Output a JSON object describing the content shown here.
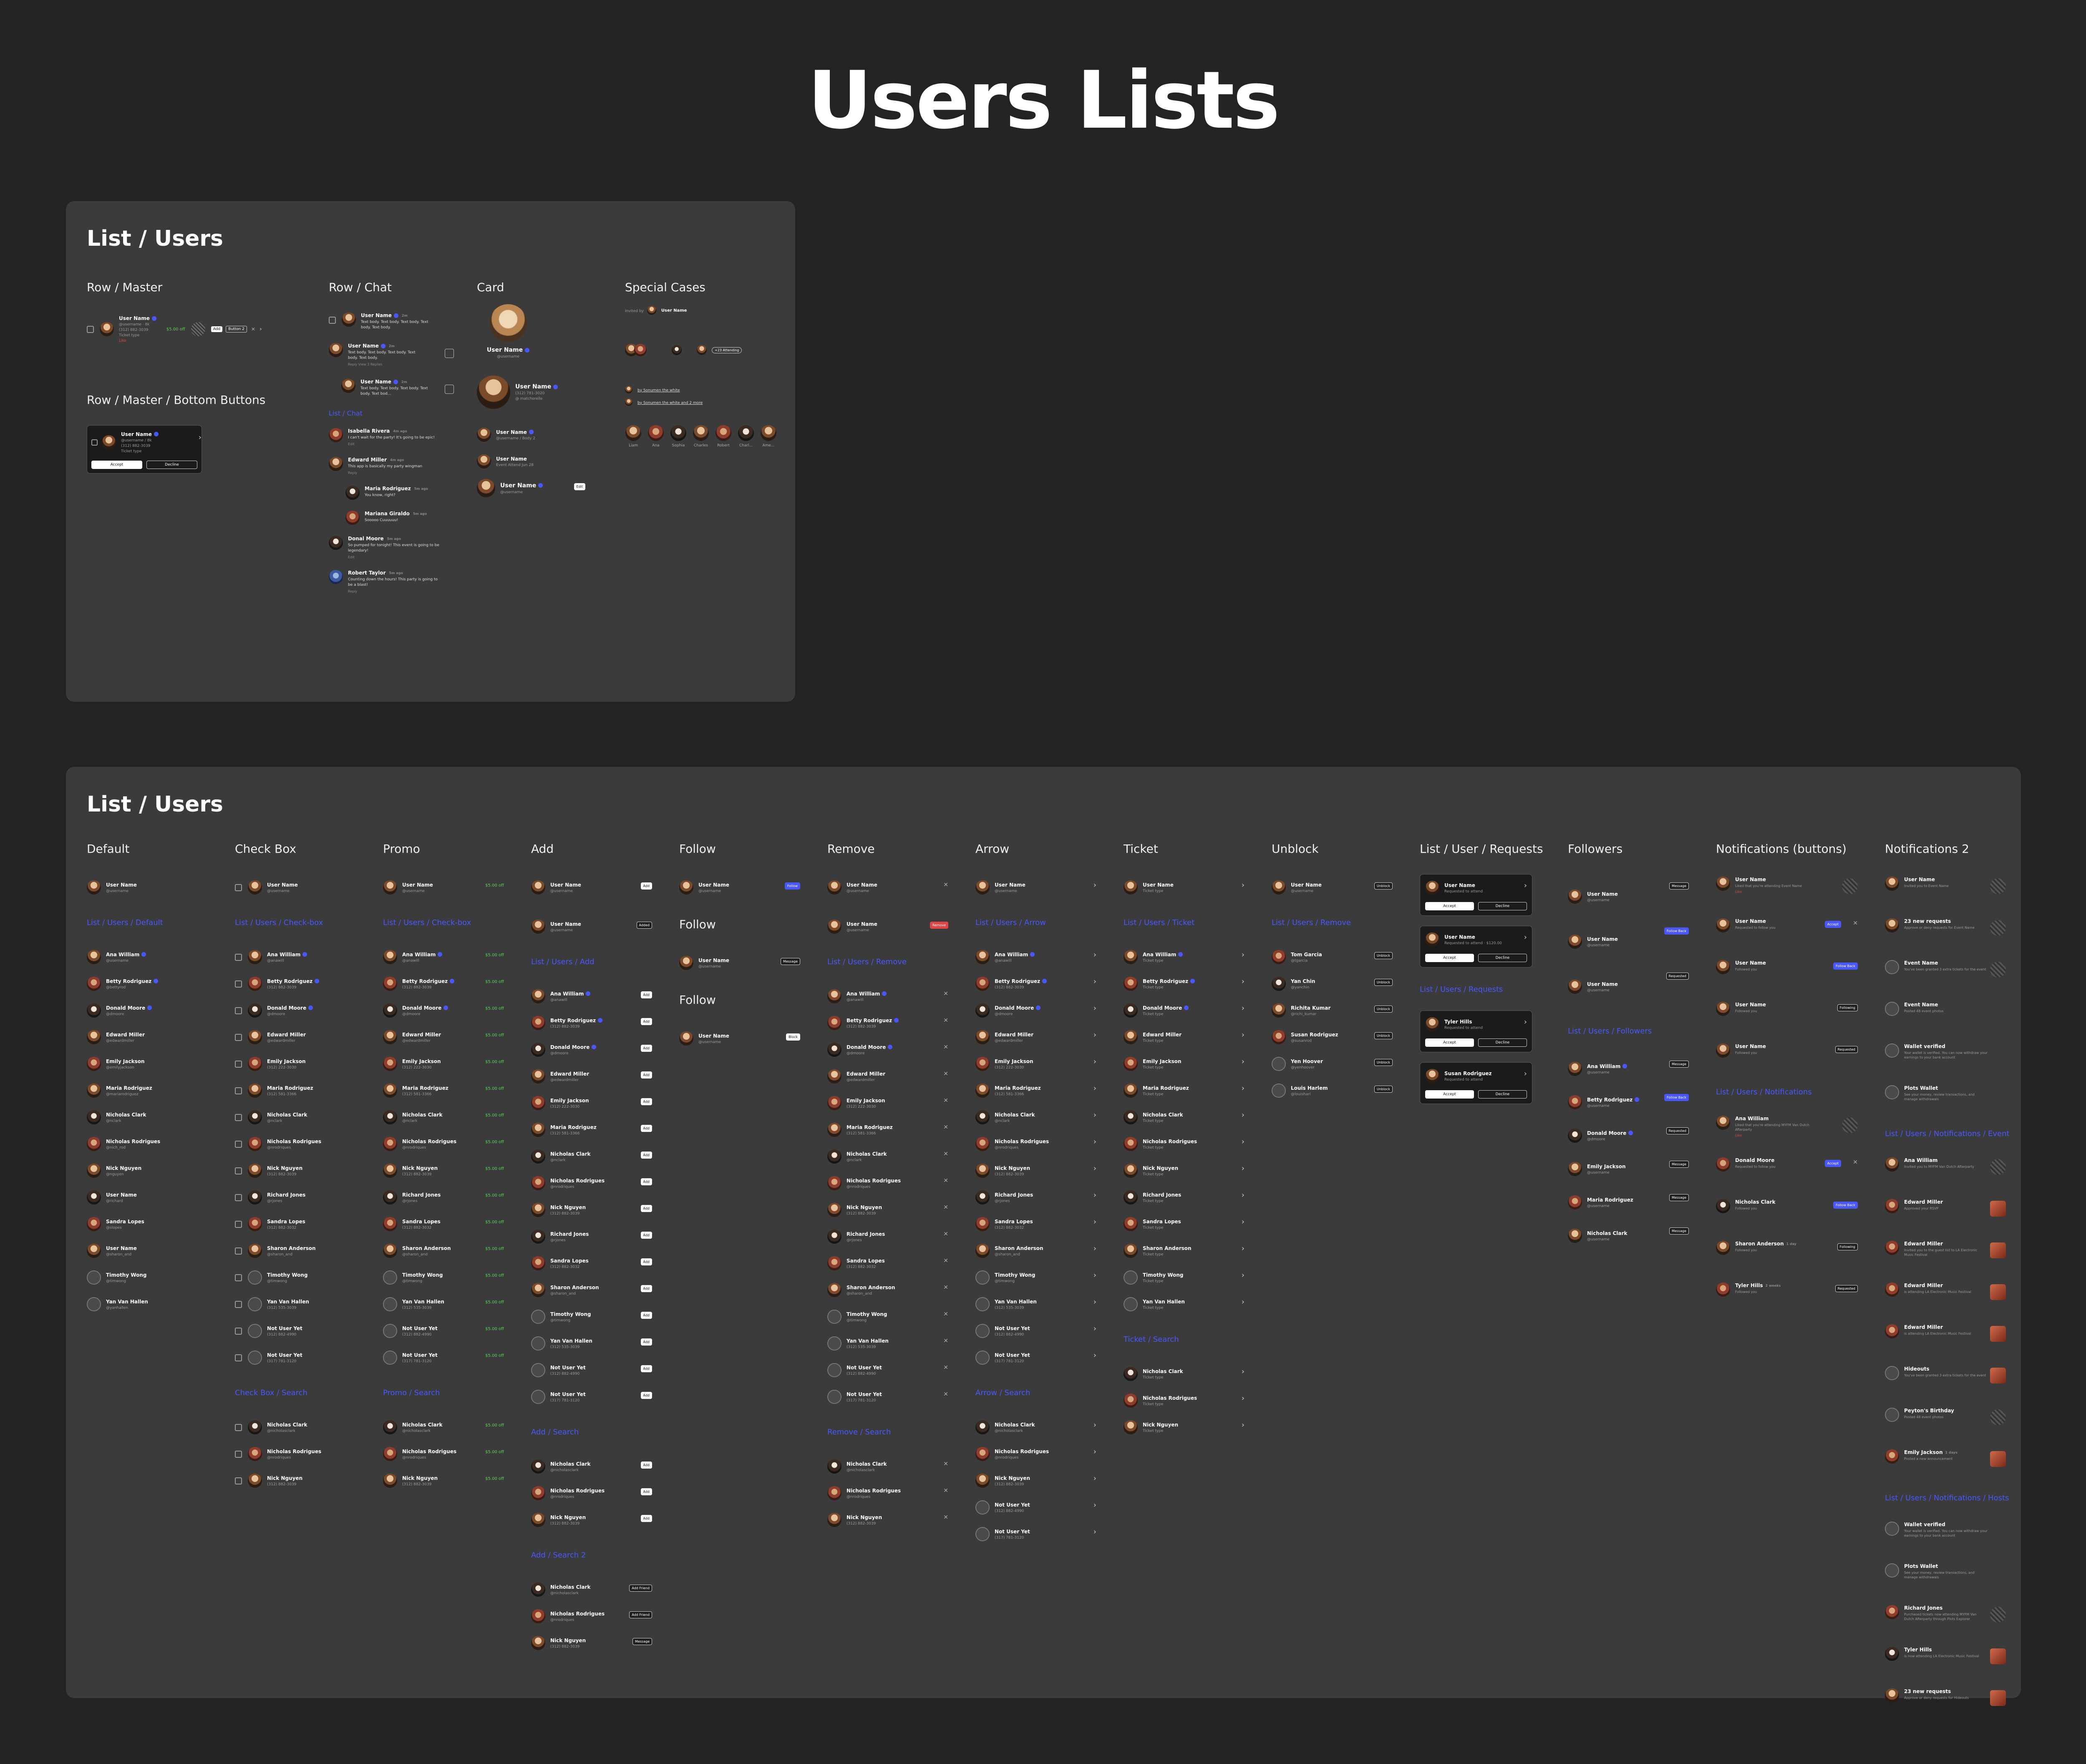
{
  "page_title": "Users Lists",
  "panel1": {
    "title": "List / Users",
    "row_master": {
      "title": "Row / Master",
      "name": "User Name",
      "sub": "@username · 8k",
      "phone": "(312) 882-3039",
      "ticket": "Ticket type",
      "like": "Like",
      "price": "$5.00 off",
      "btn1": "Add",
      "btn2": "Button 2"
    },
    "row_master_bottom": {
      "title": "Row / Master / Bottom Buttons",
      "name": "User Name",
      "sub": "@username / 8k",
      "phone": "(312) 882-3039",
      "ticket": "Ticket type",
      "accept": "Accept",
      "decline": "Decline"
    },
    "row_chat": {
      "title": "Row / Chat",
      "items": [
        {
          "name": "User Name",
          "time": "2m",
          "body": "Text body. Text body. Text body. Text body. Text body."
        },
        {
          "name": "User Name",
          "time": "2m",
          "body": "Text body. Text body. Text body. Text body. Text body.",
          "actions": "Reply   View 3 Replies"
        },
        {
          "name": "User Name",
          "time": "2m",
          "body": "Text body. Text body. Text body. Text body. Text bod..."
        }
      ]
    },
    "list_chat": {
      "title": "List / Chat",
      "items": [
        {
          "name": "Isabella Rivera",
          "time": "4m ago",
          "body": "I can't wait for the party! It's going to be epic!",
          "reply": "Edit"
        },
        {
          "name": "Edward Miller",
          "time": "4m ago",
          "body": "This app is basically my party wingman",
          "reply": "Reply"
        },
        {
          "name": "Maria Rodriguez",
          "time": "5m ago",
          "body": "You know, right?"
        },
        {
          "name": "Mariana Giraldo",
          "time": "5m ago",
          "body": "Sooooo Cuuuuuu!"
        },
        {
          "name": "Donal Moore",
          "time": "5m ago",
          "body": "So pumped for tonight! This event is going to be legendary!",
          "reply": "Edit"
        },
        {
          "name": "Robert Taylor",
          "time": "5m ago",
          "body": "Counting down the hours! This party is going to be a blast!",
          "reply": "Reply"
        }
      ]
    },
    "card": {
      "title": "Card",
      "c1_name": "User Name",
      "c1_sub": "@username",
      "c2_name": "User Name",
      "c2_sub": "(312) 781-3020",
      "c2_handle": "@ matchorelle",
      "c3_name": "User Name",
      "c3_sub": "@username / Body 2",
      "c4_name": "User Name",
      "c4_sub": "Event Attend Jun 28",
      "c5_name": "User Name",
      "c5_sub": "@username",
      "c5_btn": "Edit"
    },
    "special": {
      "title": "Special Cases",
      "invited_by": "Invited by",
      "invited_name": "User Name",
      "attending": "+23 Attending",
      "by1": "by Sonumen the white",
      "by2": "by Sonumen the white and 2 more",
      "names": [
        "Liam",
        "Ana",
        "Sophia",
        "Charles",
        "Robert",
        "Charl...",
        "Ame..."
      ]
    }
  },
  "panel2": {
    "title": "List / Users",
    "default": {
      "title": "Default",
      "top": {
        "name": "User Name",
        "sub": "@username"
      },
      "section": "List / Users / Default",
      "items": [
        {
          "name": "Ana William",
          "sub": "@username"
        },
        {
          "name": "Betty Rodriguez",
          "sub": "@bettyrod"
        },
        {
          "name": "Donald Moore",
          "sub": "@dmoore"
        },
        {
          "name": "Edward Miller",
          "sub": "@edwardmiller"
        },
        {
          "name": "Emily Jackson",
          "sub": "@emilyjackson"
        },
        {
          "name": "Maria Rodriguez",
          "sub": "@mariarodriguez"
        },
        {
          "name": "Nicholas Clark",
          "sub": "@nclark"
        },
        {
          "name": "Nicholas Rodrigues",
          "sub": "@nich_rod"
        },
        {
          "name": "Nick Nguyen",
          "sub": "@nguyen"
        },
        {
          "name": "User Name",
          "sub": "@richard"
        },
        {
          "name": "Sandra Lopes",
          "sub": "@slopes"
        },
        {
          "name": "User Name",
          "sub": "@sharon_and"
        },
        {
          "name": "Timothy Wong",
          "sub": "@timwong"
        },
        {
          "name": "Yan Van Hallen",
          "sub": "@yanhallen"
        }
      ]
    },
    "checkbox": {
      "title": "Check Box",
      "top": {
        "name": "User Name",
        "sub": "@username"
      },
      "section": "List / Users / Check-box",
      "search": "Check Box / Search"
    },
    "promo": {
      "title": "Promo",
      "top": {
        "name": "User Name",
        "sub": "@username"
      },
      "section": "List / Users / Check-box",
      "search": "Promo / Search",
      "price": "$5.00 off"
    },
    "add": {
      "title": "Add",
      "top": {
        "name": "User Name",
        "sub": "@username"
      },
      "top2": {
        "name": "User Name",
        "sub": "@username"
      },
      "btn": "Add",
      "btn_added": "Added",
      "section": "List / Users / Add",
      "search": "Add / Search",
      "search2": "Add / Search 2",
      "add_friend": "Add Friend",
      "message": "Message"
    },
    "follow": {
      "title": "Follow",
      "top": {
        "name": "User Name",
        "sub": "@username"
      },
      "btn": "Follow",
      "title2": "Follow",
      "top2": {
        "name": "User Name",
        "sub": "@username"
      },
      "btn2": "Message",
      "title3": "Follow",
      "top3": {
        "name": "User Name",
        "sub": "@username"
      },
      "btn3": "Block"
    },
    "remove": {
      "title": "Remove",
      "top": {
        "name": "User Name",
        "sub": "@username"
      },
      "top2": {
        "name": "User Name",
        "sub": "@username"
      },
      "btn": "Remove",
      "section": "List / Users / Remove",
      "search": "Remove / Search"
    },
    "arrow": {
      "title": "Arrow",
      "top": {
        "name": "User Name",
        "sub": "@username"
      },
      "section": "List / Users / Arrow",
      "search": "Arrow / Search"
    },
    "ticket": {
      "title": "Ticket",
      "top": {
        "name": "User Name",
        "sub": "Ticket type"
      },
      "section": "List / Users / Ticket",
      "search": "Ticket / Search",
      "ticket": "Ticket type"
    },
    "unblock": {
      "title": "Unblock",
      "top": {
        "name": "User Name",
        "sub": "@username"
      },
      "btn": "Unblock",
      "section": "List / Users / Remove",
      "items": [
        {
          "name": "Tom Garcia",
          "sub": "@tgarcia"
        },
        {
          "name": "Yan Chin",
          "sub": "@yanchin"
        },
        {
          "name": "Richita Kumar",
          "sub": "@richi_kumar"
        },
        {
          "name": "Susan Rodriguez",
          "sub": "@susanrod"
        },
        {
          "name": "Yen Hoover",
          "sub": "@yenhoover"
        },
        {
          "name": "Louis Harlem",
          "sub": "@louisharl"
        }
      ]
    },
    "requests": {
      "title": "List / User / Requests",
      "items": [
        {
          "name": "User Name",
          "sub": "Requested to attend"
        },
        {
          "name": "User Name",
          "sub": "Requested to attend · $120.00",
          "ticket": "VIP Tickets"
        }
      ],
      "section": "List / Users / Requests",
      "items2": [
        {
          "name": "Tyler Hills",
          "sub": "Requested to attend"
        },
        {
          "name": "Susan Rodriguez",
          "sub": "Requested to attend"
        }
      ],
      "accept": "Accept",
      "decline": "Decline"
    },
    "followers": {
      "title": "Followers",
      "top": [
        {
          "name": "User Name",
          "sub": "@username",
          "btn": "Message"
        },
        {
          "name": "User Name",
          "sub": "@username",
          "btn": "Follow Back"
        },
        {
          "name": "User Name",
          "sub": "@username",
          "btn": "Requested"
        }
      ],
      "section": "List / Users / Followers",
      "items": [
        {
          "name": "Ana William",
          "sub": "@username",
          "btn": "Message"
        },
        {
          "name": "Betty Rodriguez",
          "sub": "@username",
          "btn": "Follow Back"
        },
        {
          "name": "Donald Moore",
          "sub": "@dmoore",
          "btn": "Requested"
        },
        {
          "name": "Emily Jackson",
          "sub": "@username",
          "btn": "Message"
        },
        {
          "name": "Maria Rodriguez",
          "sub": "@username",
          "btn": "Message"
        },
        {
          "name": "Nicholas Clark",
          "sub": "@username",
          "btn": "Message"
        }
      ]
    },
    "notif_btn": {
      "title": "Notifications (buttons)",
      "top": [
        {
          "name": "User Name",
          "sub": "Liked that you're attending Event Name",
          "like": "Like"
        },
        {
          "name": "User Name",
          "sub": "Requested to follow you",
          "btn": "Accept"
        },
        {
          "name": "User Name",
          "sub": "Followed you",
          "btn": "Follow Back"
        },
        {
          "name": "User Name",
          "sub": "Followed you",
          "btn": "Following"
        },
        {
          "name": "User Name",
          "sub": "Followed you",
          "btn": "Requested"
        }
      ],
      "section": "List / Users / Notifications",
      "items": [
        {
          "name": "Ana William",
          "sub": "Liked that you're attending MYFM Van Dutch Afterparty",
          "like": "Like"
        },
        {
          "name": "Donald Moore",
          "sub": "Requested to follow you",
          "btn": "Accept"
        },
        {
          "name": "Nicholas Clark",
          "sub": "Followed you",
          "btn": "Follow Back"
        },
        {
          "name": "Sharon Anderson",
          "sub": "Followed you",
          "btn": "Following",
          "time": "1 day"
        },
        {
          "name": "Tyler Hills",
          "sub": "Followed you",
          "btn": "Requested",
          "time": "2 weeks"
        }
      ]
    },
    "notif2": {
      "title": "Notifications 2",
      "top": [
        {
          "name": "User Name",
          "sub": "Invited you to Event Name"
        },
        {
          "name": "23 new requests",
          "sub": "Approve or deny requests for Event Name"
        },
        {
          "name": "Event Name",
          "sub": "You've been granted 3 extra tickets for the event"
        },
        {
          "name": "Event Name",
          "sub": "Posted 48 event photos"
        },
        {
          "name": "Wallet verified",
          "sub": "Your wallet is verified. You can now withdraw your earnings to your bank account"
        },
        {
          "name": "Plots Wallet",
          "sub": "See your money, review transactions, and manage withdrawals"
        }
      ],
      "section": "List / Users / Notifications / Event",
      "items": [
        {
          "name": "Ana William",
          "sub": "Invited you to MYFM Van Dutch Afterparty"
        },
        {
          "name": "Edward Miller",
          "sub": "Approved your RSVP"
        },
        {
          "name": "Edward Miller",
          "sub": "Invited you to the guest list to LA Electronic Music Festival"
        },
        {
          "name": "Edward Miller",
          "sub": "is attending LA Electronic Music Festival"
        },
        {
          "name": "Edward Miller",
          "sub": "is attending LA Electronic Music Festival"
        },
        {
          "name": "Hideouts",
          "sub": "You've been granted 3 extra tickets for the event"
        },
        {
          "name": "Peyton's Birthday",
          "sub": "Posted 48 event photos"
        },
        {
          "name": "Emily Jackson",
          "sub": "Posted a new announcement",
          "time": "1 days"
        }
      ],
      "section2": "List / Users / Notifications / Hosts",
      "items2": [
        {
          "name": "Wallet verified",
          "sub": "Your wallet is verified. You can now withdraw your earnings to your bank account"
        },
        {
          "name": "Plots Wallet",
          "sub": "See your money, review transactions, and manage withdrawals"
        },
        {
          "name": "Richard Jones",
          "sub": "Purchased tickets now attending MYFM Van Dutch Afterparty through Plots Explorer"
        },
        {
          "name": "Tyler Hills",
          "sub": "is now attending LA Electronic Music Festival"
        },
        {
          "name": "23 new requests",
          "sub": "Approve or deny requests for Hideouts"
        }
      ]
    },
    "people": [
      {
        "name": "Ana William",
        "sub": "@anawill"
      },
      {
        "name": "Betty Rodriguez",
        "sub": "(312) 882-3039"
      },
      {
        "name": "Donald Moore",
        "sub": "@dmoore"
      },
      {
        "name": "Edward Miller",
        "sub": "@edwardmiller"
      },
      {
        "name": "Emily Jackson",
        "sub": "(312) 222-3030"
      },
      {
        "name": "Maria Rodriguez",
        "sub": "(312) 581-3366"
      },
      {
        "name": "Nicholas Clark",
        "sub": "@nclark"
      },
      {
        "name": "Nicholas Rodrigues",
        "sub": "@nrodriques"
      },
      {
        "name": "Nick Nguyen",
        "sub": "(312) 882-3039"
      },
      {
        "name": "Richard Jones",
        "sub": "@rjones"
      },
      {
        "name": "Sandra Lopes",
        "sub": "(312) 882-3032"
      },
      {
        "name": "Sharon Anderson",
        "sub": "@sharon_and"
      },
      {
        "name": "Timothy Wong",
        "sub": "@timwong"
      },
      {
        "name": "Yan Van Hallen",
        "sub": "(312) 535-3039"
      },
      {
        "name": "Not User Yet",
        "sub": "(312) 882-4990"
      },
      {
        "name": "Not User Yet",
        "sub": "(317) 781-3120"
      }
    ],
    "search_people": [
      {
        "name": "Nicholas Clark",
        "sub": "@nicholasclark"
      },
      {
        "name": "Nicholas Rodrigues",
        "sub": "@nrodriques"
      },
      {
        "name": "Nick Nguyen",
        "sub": "(312) 882-3039"
      }
    ]
  }
}
